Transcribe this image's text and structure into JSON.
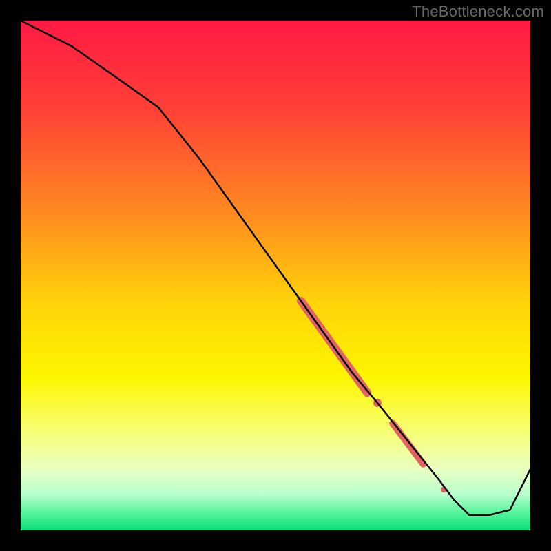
{
  "watermark": "TheBottleneck.com",
  "chart_data": {
    "type": "line",
    "title": "",
    "xlabel": "",
    "ylabel": "",
    "xlim": [
      0,
      100
    ],
    "ylim": [
      0,
      100
    ],
    "background_gradient": {
      "stops": [
        {
          "offset": 0.0,
          "color": "#ff1a44"
        },
        {
          "offset": 0.18,
          "color": "#ff4236"
        },
        {
          "offset": 0.38,
          "color": "#ff8b20"
        },
        {
          "offset": 0.55,
          "color": "#ffd209"
        },
        {
          "offset": 0.7,
          "color": "#fef600"
        },
        {
          "offset": 0.8,
          "color": "#f8ff6e"
        },
        {
          "offset": 0.88,
          "color": "#e9ffc0"
        },
        {
          "offset": 0.93,
          "color": "#b7ffce"
        },
        {
          "offset": 0.965,
          "color": "#57f49c"
        },
        {
          "offset": 1.0,
          "color": "#0ade7a"
        }
      ]
    },
    "series": [
      {
        "name": "bottleneck-curve",
        "color": "#000000",
        "x": [
          0,
          10,
          20,
          27,
          35,
          45,
          55,
          60,
          65,
          70,
          74,
          78,
          82,
          85,
          88,
          92,
          96,
          100
        ],
        "y": [
          100,
          95,
          88,
          83,
          73,
          59,
          45,
          38,
          31,
          25,
          20,
          15,
          10,
          6,
          3,
          3,
          4,
          12
        ]
      }
    ],
    "highlight_segments": [
      {
        "name": "segment-1",
        "color": "#e16363",
        "x": [
          55,
          68
        ],
        "y": [
          45,
          27
        ],
        "width": 12
      },
      {
        "name": "dot-1",
        "color": "#e16363",
        "x": [
          70
        ],
        "y": [
          25
        ],
        "width": 12
      },
      {
        "name": "segment-2",
        "color": "#e16363",
        "x": [
          73,
          79
        ],
        "y": [
          21,
          13
        ],
        "width": 10
      },
      {
        "name": "dot-2",
        "color": "#e16363",
        "x": [
          83
        ],
        "y": [
          8
        ],
        "width": 9
      }
    ]
  }
}
